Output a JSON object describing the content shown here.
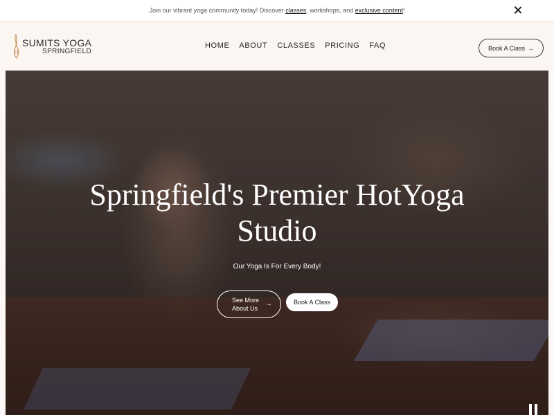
{
  "announcement": {
    "text_before": "Join our vibrant yoga community today! Discover ",
    "link_classes": "classes",
    "text_middle": ", workshops, and ",
    "link_exclusive": "exclusive content",
    "text_after": "!"
  },
  "header": {
    "logo_main": "SUMITS YOGA",
    "logo_sub": "SPRINGFIELD",
    "nav": [
      "HOME",
      "ABOUT",
      "CLASSES",
      "PRICING",
      "FAQ"
    ],
    "book_button": "Book A Class",
    "book_arrow": "→"
  },
  "hero": {
    "title_line1": "Springfield's Premier HotYoga",
    "title_line2": "Studio",
    "subtitle": "Our Yoga Is For Every Body!",
    "see_more_label": "See More About Us",
    "see_more_arrow": "→",
    "book_label": "Book A Class"
  },
  "colors": {
    "accent_logo": "#c8955e",
    "header_bg": "#fcf6f3",
    "text_dark": "#222222"
  },
  "icons": [
    "logo-flame-icon",
    "close-icon",
    "arrow-right-icon",
    "pause-icon"
  ]
}
